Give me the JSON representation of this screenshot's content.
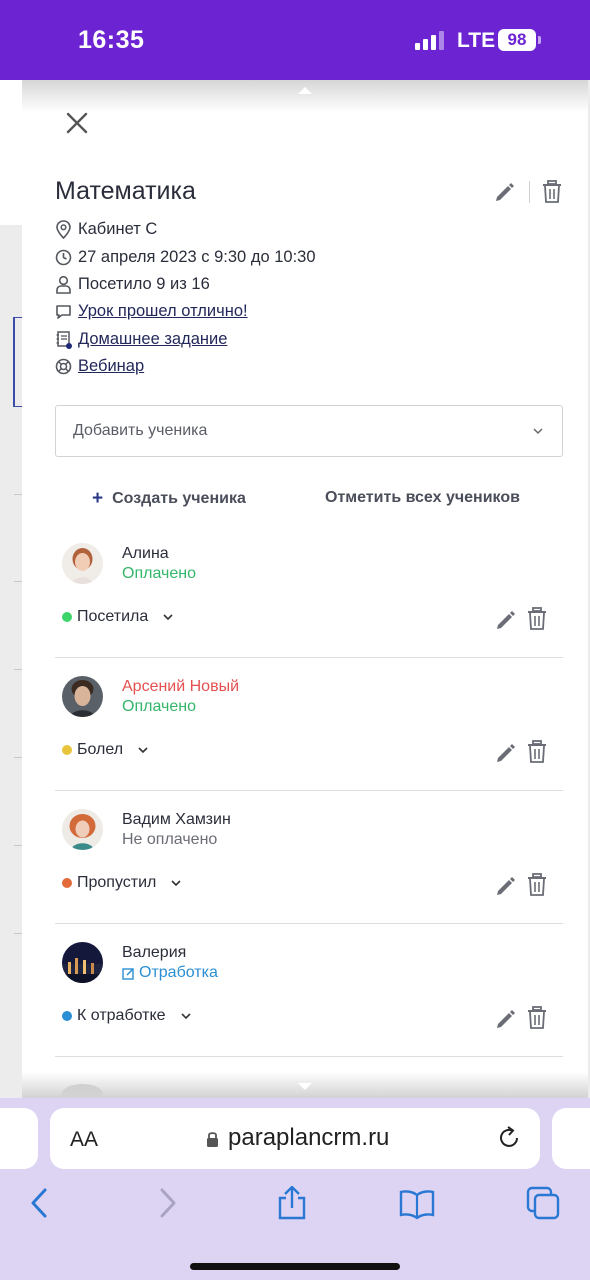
{
  "status_bar": {
    "time": "16:35",
    "network": "LTE",
    "battery": "98"
  },
  "lesson": {
    "title": "Математика",
    "room": "Кабинет С",
    "datetime": "27 апреля 2023 с 9:30 до 10:30",
    "attendance": "Посетило 9 из 16",
    "comment_link": "Урок прошел отлично!",
    "homework_link": "Домашнее задание",
    "webinar_link": "Вебинар"
  },
  "add_student": {
    "placeholder": "Добавить ученика"
  },
  "actions": {
    "create_student": "Создать ученика",
    "mark_all": "Отметить всех учеников"
  },
  "students": [
    {
      "name": "Алина",
      "payment": "Оплачено",
      "payment_color": "#33b56a",
      "name_color": "#2a2d3a",
      "status": "Посетила",
      "status_color": "#3dd46a"
    },
    {
      "name": "Арсений Новый",
      "payment": "Оплачено",
      "payment_color": "#33b56a",
      "name_color": "#e45050",
      "status": "Болел",
      "status_color": "#e8c43a"
    },
    {
      "name": "Вадим Хамзин",
      "payment": "Не оплачено",
      "payment_color": "#6a6d76",
      "name_color": "#2a2d3a",
      "status": "Пропустил",
      "status_color": "#e46a3a"
    },
    {
      "name": "Валерия",
      "payment": "Отработка",
      "payment_color": "#2a8fd4",
      "name_color": "#2a2d3a",
      "status": "К отработке",
      "status_color": "#2a8fd4"
    }
  ],
  "browser": {
    "url": "paraplancrm.ru",
    "text_size_label": "AA"
  }
}
